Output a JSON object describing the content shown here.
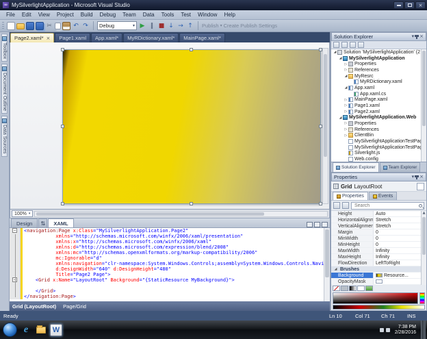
{
  "title_bar": {
    "title": "MySilverlightApplication - Microsoft Visual Studio"
  },
  "menu_bar": {
    "items": [
      "File",
      "Edit",
      "View",
      "Project",
      "Build",
      "Debug",
      "Team",
      "Data",
      "Tools",
      "Test",
      "Window",
      "Help"
    ]
  },
  "toolbar": {
    "left_icons": [
      "new-project",
      "open-file",
      "save",
      "save-all",
      "cut",
      "copy",
      "paste",
      "undo",
      "redo"
    ],
    "config_dropdown": "Debug",
    "right_icons": [
      "start-debug",
      "break-all",
      "stop-debug",
      "step-into",
      "step-over",
      "step-out"
    ],
    "publish_label": "Publish",
    "publish_settings_label": "Create Publish Settings"
  },
  "document_tabs": [
    {
      "label": "Page2.xaml*",
      "active": true
    },
    {
      "label": "Page1.xaml",
      "active": false
    },
    {
      "label": "App.xaml*",
      "active": false
    },
    {
      "label": "MyRDictionary.xaml*",
      "active": false
    },
    {
      "label": "MainPage.xaml*",
      "active": false
    }
  ],
  "left_tool_tabs": [
    "Toolbox",
    "Document Outline",
    "Data Sources"
  ],
  "design_view": {
    "zoom": "100%",
    "artboard_gradient_angle": "100deg",
    "artboard_gradient_stops": [
      "#241c02 0%",
      "#caa200 2.5%",
      "#f2d800 9%",
      "#f0d700 45%",
      "#d9cb55 65%",
      "#b5ac7e 85%",
      "#a29c87 100%"
    ]
  },
  "editor_split": {
    "design_tab": "Design",
    "xaml_tab": "XAML"
  },
  "xaml_editor": {
    "lines": [
      "<navigation:Page x:Class=\"MySilverlightApplication.Page2\"",
      "           xmlns=\"http://schemas.microsoft.com/winfx/2006/xaml/presentation\"",
      "           xmlns:x=\"http://schemas.microsoft.com/winfx/2006/xaml\"",
      "           xmlns:d=\"http://schemas.microsoft.com/expression/blend/2008\"",
      "           xmlns:mc=\"http://schemas.openxmlformats.org/markup-compatibility/2006\"",
      "           mc:Ignorable=\"d\"",
      "           xmlns:navigation=\"clr-namespace:System.Windows.Controls;assembly=System.Windows.Controls.Navigation\"",
      "           d:DesignWidth=\"640\" d:DesignHeight=\"480\"",
      "           Title=\"Page2 Page\">",
      "    <Grid x:Name=\"LayoutRoot\" Background=\"{StaticResource MyBackground}\">",
      "",
      "    </Grid>",
      "</navigation:Page>"
    ],
    "fold_lines": [
      1,
      10
    ],
    "changed_lines": [
      1,
      2,
      3,
      4,
      5,
      6,
      7,
      8,
      9,
      10,
      11,
      12,
      13
    ]
  },
  "breadcrumb": {
    "segments": [
      "Grid (LayoutRoot)",
      "Page/Grid"
    ]
  },
  "solution_explorer": {
    "title": "Solution Explorer",
    "tree": [
      {
        "label": "Solution 'MySilverlightApplication' (2 proje",
        "indent": 0,
        "icon": "solution",
        "expander": "expanded"
      },
      {
        "label": "MySilverlightApplication",
        "indent": 1,
        "icon": "project-silverlight",
        "expander": "expanded",
        "bold": true
      },
      {
        "label": "Properties",
        "indent": 2,
        "icon": "properties",
        "expander": "collapsed"
      },
      {
        "label": "References",
        "indent": 2,
        "icon": "references",
        "expander": "collapsed"
      },
      {
        "label": "MyResrc",
        "indent": 2,
        "icon": "folder",
        "expander": "expanded"
      },
      {
        "label": "MyRDictionary.xaml",
        "indent": 3,
        "icon": "xaml-file",
        "expander": "none"
      },
      {
        "label": "App.xaml",
        "indent": 2,
        "icon": "xaml-file",
        "expander": "expanded"
      },
      {
        "label": "App.xaml.cs",
        "indent": 3,
        "icon": "cs-file",
        "expander": "none"
      },
      {
        "label": "MainPage.xaml",
        "indent": 2,
        "icon": "xaml-file",
        "expander": "collapsed"
      },
      {
        "label": "Page1.xaml",
        "indent": 2,
        "icon": "xaml-file",
        "expander": "collapsed"
      },
      {
        "label": "Page2.xaml",
        "indent": 2,
        "icon": "xaml-file",
        "expander": "collapsed"
      },
      {
        "label": "MySilverlightApplication.Web",
        "indent": 1,
        "icon": "project-web",
        "expander": "expanded",
        "bold": true
      },
      {
        "label": "Properties",
        "indent": 2,
        "icon": "properties",
        "expander": "collapsed"
      },
      {
        "label": "References",
        "indent": 2,
        "icon": "references",
        "expander": "collapsed"
      },
      {
        "label": "ClientBin",
        "indent": 2,
        "icon": "folder",
        "expander": "collapsed"
      },
      {
        "label": "MySilverlightApplicationTestPage.a",
        "indent": 2,
        "icon": "aspx-file",
        "expander": "none"
      },
      {
        "label": "MySilverlightApplicationTestPage.h",
        "indent": 2,
        "icon": "html-file",
        "expander": "none"
      },
      {
        "label": "Silverlight.js",
        "indent": 2,
        "icon": "js-file",
        "expander": "none"
      },
      {
        "label": "Web.config",
        "indent": 2,
        "icon": "config-file",
        "expander": "none"
      }
    ],
    "bottom_tabs": [
      "Solution Explorer",
      "Team Explorer"
    ]
  },
  "properties_panel": {
    "title": "Properties",
    "object_type": "Grid",
    "object_name": "LayoutRoot",
    "tabs": [
      "Properties",
      "Events"
    ],
    "search_placeholder": "Search",
    "rows": [
      {
        "name": "Height",
        "value": "Auto"
      },
      {
        "name": "HorizontalAlignme",
        "value": "Stretch"
      },
      {
        "name": "VerticalAlignment",
        "value": "Stretch"
      },
      {
        "name": "Margin",
        "value": "0"
      },
      {
        "name": "MinWidth",
        "value": "0"
      },
      {
        "name": "MinHeight",
        "value": "0"
      },
      {
        "name": "MaxWidth",
        "value": "Infinity"
      },
      {
        "name": "MaxHeight",
        "value": "Infinity"
      },
      {
        "name": "FlowDirection",
        "value": "LeftToRight"
      },
      {
        "name": "Brushes",
        "section": true
      },
      {
        "name": "Background",
        "value": "Resource...",
        "selected": true,
        "swatch": "gold"
      },
      {
        "name": "OpacityMask",
        "value": "",
        "swatch": "empty"
      }
    ]
  },
  "status_bar": {
    "message": "Ready",
    "line": "Ln 10",
    "col": "Col 71",
    "ch": "Ch 71",
    "mode": "INS"
  },
  "taskbar": {
    "time": "7:38 PM",
    "date": "2/28/2016"
  }
}
